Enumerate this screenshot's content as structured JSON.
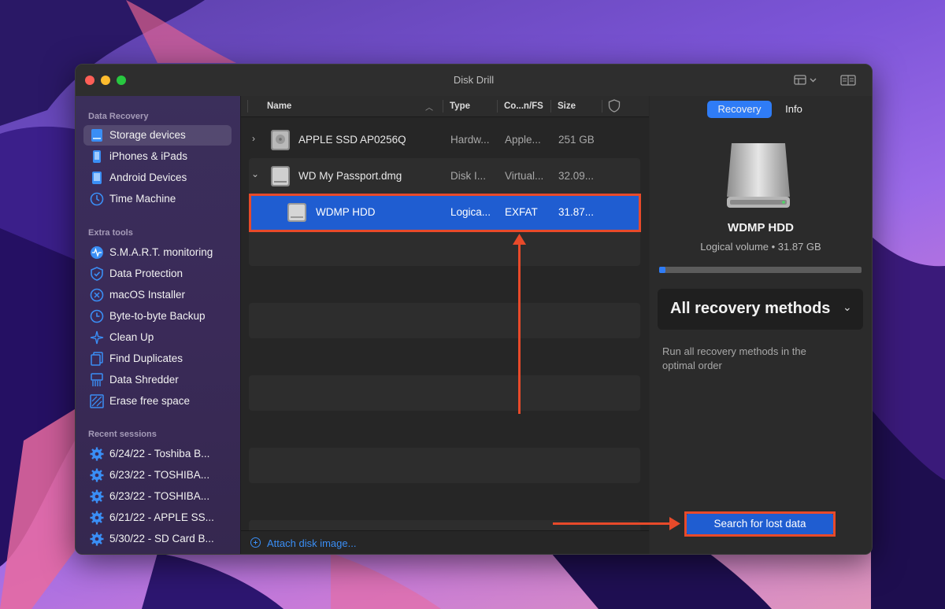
{
  "window": {
    "title": "Disk Drill"
  },
  "sidebar": {
    "data_recovery_header": "Data Recovery",
    "data_recovery_items": [
      {
        "label": "Storage devices",
        "icon": "storage-device-icon",
        "selected": true
      },
      {
        "label": "iPhones & iPads",
        "icon": "iphone-icon"
      },
      {
        "label": "Android Devices",
        "icon": "android-device-icon"
      },
      {
        "label": "Time Machine",
        "icon": "time-machine-icon"
      }
    ],
    "extra_tools_header": "Extra tools",
    "extra_tools_items": [
      {
        "label": "S.M.A.R.T. monitoring",
        "icon": "smart-monitoring-icon"
      },
      {
        "label": "Data Protection",
        "icon": "shield-icon"
      },
      {
        "label": "macOS Installer",
        "icon": "macos-installer-icon"
      },
      {
        "label": "Byte-to-byte Backup",
        "icon": "backup-icon"
      },
      {
        "label": "Clean Up",
        "icon": "clean-up-icon"
      },
      {
        "label": "Find Duplicates",
        "icon": "duplicates-icon"
      },
      {
        "label": "Data Shredder",
        "icon": "shredder-icon"
      },
      {
        "label": "Erase free space",
        "icon": "erase-icon"
      }
    ],
    "recent_sessions_header": "Recent sessions",
    "recent_sessions": [
      {
        "label": "6/24/22 - Toshiba B...",
        "icon": "gear-icon"
      },
      {
        "label": "6/23/22 - TOSHIBA...",
        "icon": "gear-icon"
      },
      {
        "label": "6/23/22 - TOSHIBA...",
        "icon": "gear-icon"
      },
      {
        "label": "6/21/22 - APPLE SS...",
        "icon": "gear-icon"
      },
      {
        "label": "5/30/22 - SD Card B...",
        "icon": "gear-icon"
      }
    ]
  },
  "device_list": {
    "columns": [
      "Name",
      "Type",
      "Co...n/FS",
      "Size"
    ],
    "rows": [
      {
        "name": "APPLE SSD AP0256Q",
        "type": "Hardw...",
        "fs": "Apple...",
        "size": "251 GB",
        "expanded": false
      },
      {
        "name": "WD My Passport.dmg",
        "type": "Disk I...",
        "fs": "Virtual...",
        "size": "32.09...",
        "expanded": true
      },
      {
        "name": "WDMP HDD",
        "type": "Logica...",
        "fs": "EXFAT",
        "size": "31.87...",
        "selected": true
      }
    ],
    "attach_label": "Attach disk image..."
  },
  "right_panel": {
    "tabs": [
      {
        "label": "Recovery",
        "active": true
      },
      {
        "label": "Info",
        "active": false
      }
    ],
    "device_name": "WDMP HDD",
    "device_subtitle": "Logical volume • 31.87 GB",
    "usage_fraction": 0.03,
    "method_label": "All recovery methods",
    "method_description": "Run all recovery methods in the optimal order",
    "search_button": "Search for lost data"
  },
  "colors": {
    "accent": "#1f5dd1",
    "highlight": "#e84a2a"
  }
}
